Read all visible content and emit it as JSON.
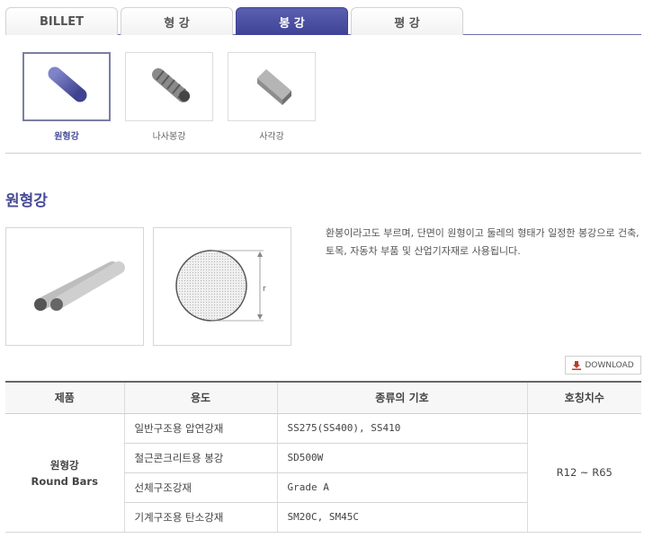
{
  "tabs": [
    {
      "label": "BILLET"
    },
    {
      "label": "형 강"
    },
    {
      "label": "봉 강"
    },
    {
      "label": "평 강"
    }
  ],
  "products": [
    {
      "label": "원형강"
    },
    {
      "label": "나사봉강"
    },
    {
      "label": "사각강"
    }
  ],
  "section": {
    "title": "원형강",
    "description": "환봉이라고도 부르며, 단면이 원형이고 둘레의 형태가 일정한 봉강으로 건축, 토목, 자동차 부품 및 산업기자재로 사용됩니다.",
    "diagram_label": "r"
  },
  "download_label": "DOWNLOAD",
  "table": {
    "headers": [
      "제품",
      "용도",
      "종류의 기호",
      "호칭치수"
    ],
    "product_name": "원형강",
    "product_name_en": "Round Bars",
    "size": "R12 ~ R65",
    "rows": [
      {
        "use": "일반구조용 압연강재",
        "symbol": "SS275(SS400), SS410"
      },
      {
        "use": "철근콘크리트용 봉강",
        "symbol": "SD500W"
      },
      {
        "use": "선체구조강재",
        "symbol": "Grade A"
      },
      {
        "use": "기계구조용 탄소강재",
        "symbol": "SM20C, SM45C"
      }
    ]
  }
}
